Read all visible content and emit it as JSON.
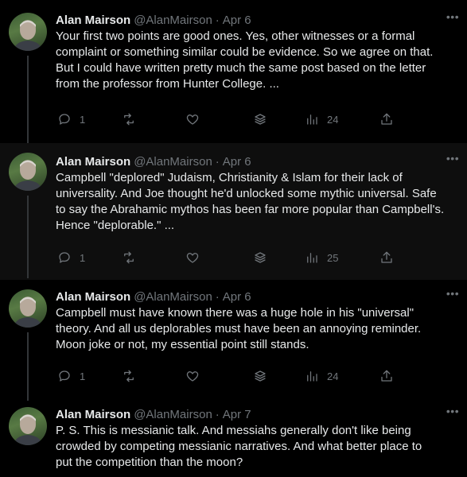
{
  "tweets": [
    {
      "name": "Alan Mairson",
      "handle": "@AlanMairson",
      "dot": "·",
      "date": "Apr 6",
      "lines": [
        "Your first two points are good ones. Yes, other witnesses or a formal",
        "complaint or something similar could be evidence. So we agree on that.",
        "But I could have written pretty much the same post based on the letter",
        "from the professor from Hunter College. ..."
      ],
      "replies": "1",
      "views": "24"
    },
    {
      "name": "Alan Mairson",
      "handle": "@AlanMairson",
      "dot": "·",
      "date": "Apr 6",
      "lines": [
        "Campbell \"deplored\" Judaism, Christianity & Islam for their lack of",
        "universality. And Joe thought he'd unlocked some mythic universal. Safe",
        "to say the Abrahamic mythos has been far more popular than Campbell's.",
        "Hence \"deplorable.\" ..."
      ],
      "replies": "1",
      "views": "25"
    },
    {
      "name": "Alan Mairson",
      "handle": "@AlanMairson",
      "dot": "·",
      "date": "Apr 6",
      "lines": [
        "Campbell must have known there was a huge hole in his \"universal\"",
        "theory. And all us deplorables must have been an annoying reminder.",
        "Moon joke or not, my essential point still stands."
      ],
      "replies": "1",
      "views": "24"
    },
    {
      "name": "Alan Mairson",
      "handle": "@AlanMairson",
      "dot": "·",
      "date": "Apr 7",
      "lines": [
        "P. S. This is messianic talk. And messiahs generally don't like being",
        "crowded by competing messianic narratives. And what  better place to",
        "put the competition than the moon?"
      ]
    }
  ],
  "icons": {
    "more": "more-icon",
    "reply": "reply-icon",
    "retweet": "retweet-icon",
    "like": "like-icon",
    "stack": "stack-icon",
    "views": "views-icon",
    "share": "share-icon"
  },
  "colors": {
    "background": "#000000",
    "highlight_background": "#0e0e0e",
    "text": "#e7e9ea",
    "secondary": "#71767b",
    "thread_line": "#333639"
  }
}
